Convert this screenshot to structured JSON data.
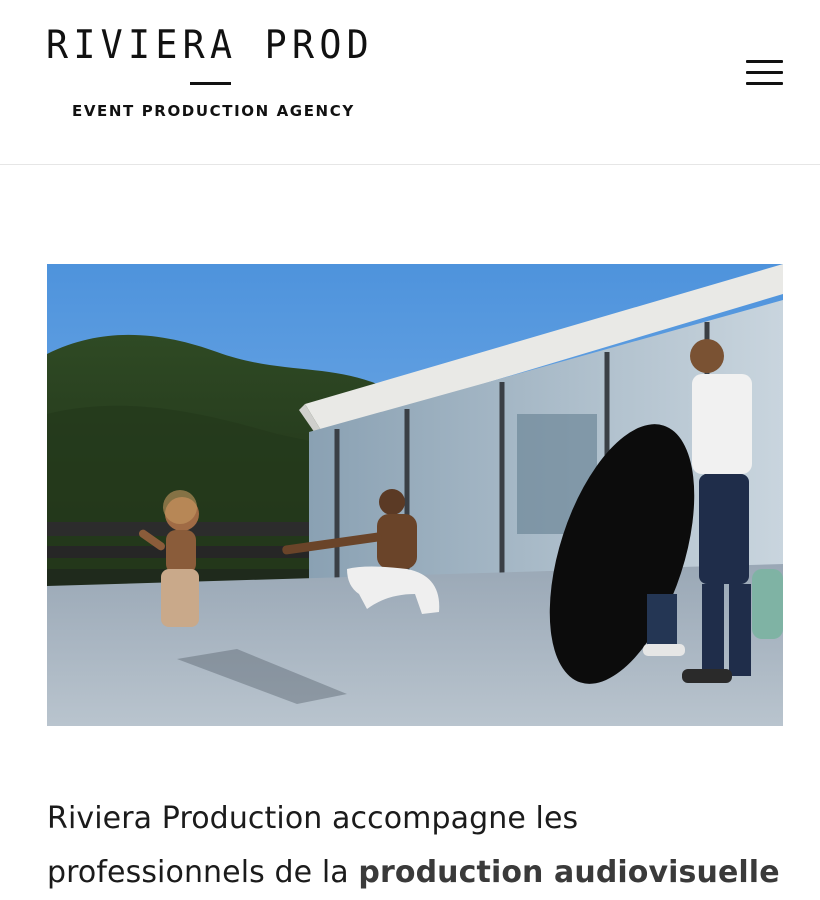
{
  "header": {
    "logo": {
      "wordmark": "RIVIERA PROD",
      "tagline": "EVENT PRODUCTION AGENCY"
    },
    "menu_icon": "hamburger-menu-icon"
  },
  "hero": {
    "image": "photo-shoot-on-terrace"
  },
  "intro": {
    "text_before": "Riviera Production accompagne les professionnels de la ",
    "text_bold": "production audiovisuelle"
  },
  "colors": {
    "text": "#1b1b1b",
    "header_border": "#e6e6e6",
    "sky": "#5f9ddd"
  }
}
